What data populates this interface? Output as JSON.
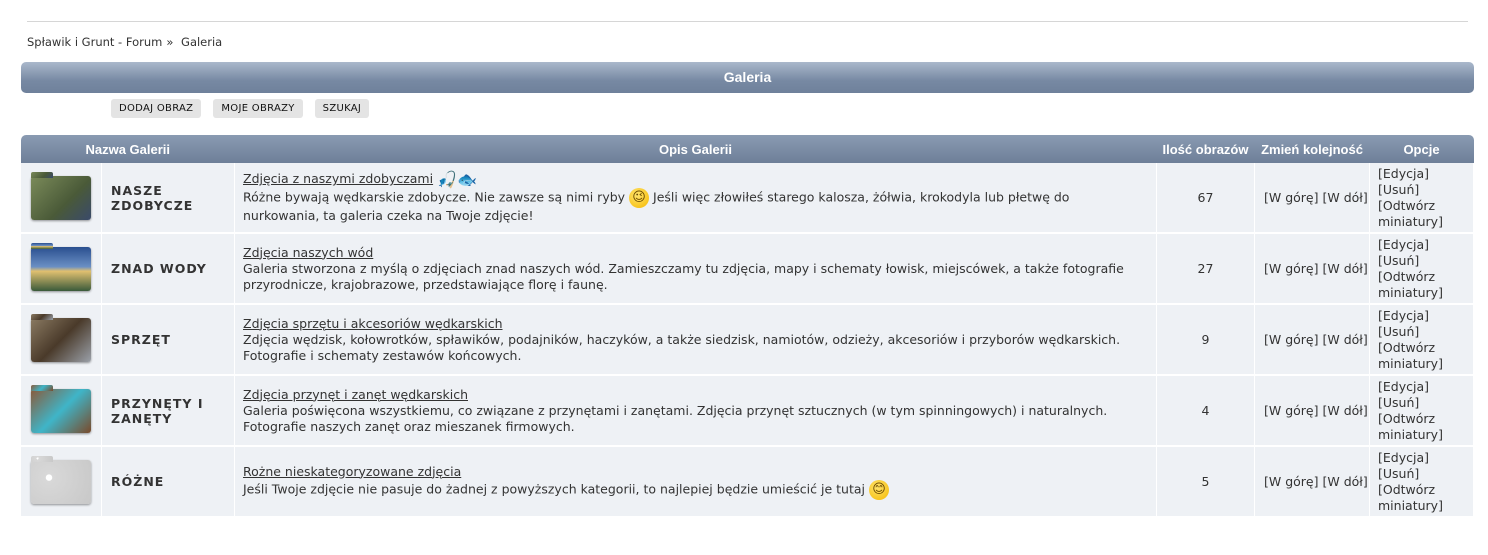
{
  "breadcrumb": {
    "home": "Spławik i Grunt - Forum",
    "sep": "»",
    "current": "Galeria"
  },
  "title": "Galeria",
  "actions": {
    "add": "DODAJ OBRAZ",
    "mine": "MOJE OBRAZY",
    "search": "SZUKAJ"
  },
  "columns": {
    "name": "Nazwa Galerii",
    "desc": "Opis Galerii",
    "count": "Ilość obrazów",
    "order": "Zmień kolejność",
    "options": "Opcje"
  },
  "rows": [
    {
      "name": "NASZE ZDOBYCZE",
      "title": "Zdjęcia z naszymi zdobyczami",
      "desc_a": "Różne bywają wędkarskie zdobycze. Nie zawsze są nimi ryby",
      "desc_b": "Jeśli więc złowiłeś starego kalosza, żółwia, krokodyla lub płetwę do nurkowania, ta galeria czeka na Twoje zdjęcie!",
      "count": "67",
      "thumb": "#5a6b4a"
    },
    {
      "name": "ZNAD WODY",
      "title": "Zdjęcia naszych wód",
      "desc_a": "Galeria stworzona z myślą o zdjęciach znad naszych wód. Zamieszczamy tu zdjęcia, mapy i schematy łowisk, miejscówek, a także fotografie przyrodnicze, krajobrazowe, przedstawiające florę i faunę.",
      "desc_b": "",
      "count": "27",
      "thumb": "#3d6aa8"
    },
    {
      "name": "SPRZĘT",
      "title": "Zdjęcia sprzętu i akcesoriów wędkarskich",
      "desc_a": "Zdjęcia wędzisk, kołowrotków, spławików, podajników, haczyków, a także siedzisk, namiotów, odzieży, akcesoriów i przyborów wędkarskich. Fotografie i schematy zestawów końcowych.",
      "desc_b": "",
      "count": "9",
      "thumb": "#6a5a48"
    },
    {
      "name": "PRZYNĘTY I ZANĘTY",
      "title": "Zdjęcia przynęt i zanęt wędkarskich",
      "desc_a": "Galeria poświęcona wszystkiemu, co związane z przynętami i zanętami. Zdjęcia przynęt sztucznych (w tym spinningowych) i naturalnych. Fotografie naszych zanęt oraz mieszanek firmowych.",
      "desc_b": "",
      "count": "4",
      "thumb": "#4a9ab5"
    },
    {
      "name": "RÓŻNE",
      "title": "Rożne nieskategoryzowane zdjęcia",
      "desc_a": "Jeśli Twoje zdjęcie nie pasuje do żadnej z powyższych kategorii, to najlepiej będzie umieścić je tutaj",
      "desc_b": "",
      "count": "5",
      "thumb": "#cfcfcf"
    }
  ],
  "order_links": {
    "up": "[W górę]",
    "down": "[W dół]"
  },
  "option_links": {
    "edit": "[Edycja]",
    "delete": "[Usuń]",
    "rebuild": "[Odtwórz miniatury]"
  },
  "icons": {
    "wink": "wink-emoji-icon",
    "smile": "smile-emoji-icon",
    "fisher": "fisherman-icon",
    "fish": "fish-icon"
  }
}
